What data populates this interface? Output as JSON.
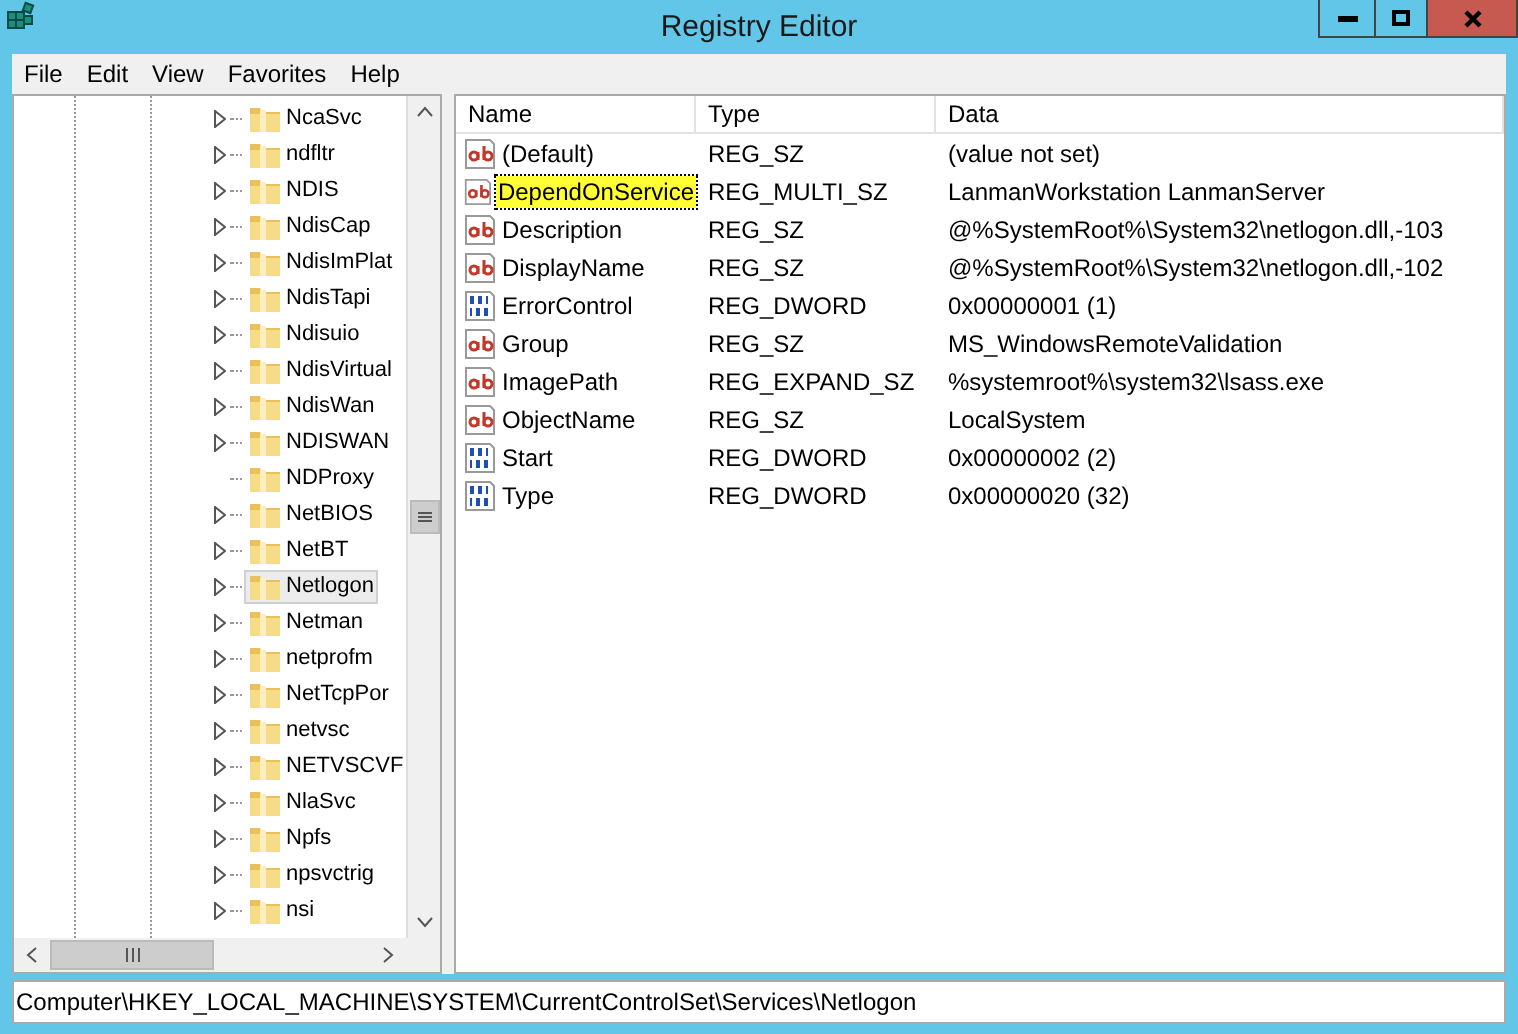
{
  "window": {
    "title": "Registry Editor"
  },
  "menu": [
    "File",
    "Edit",
    "View",
    "Favorites",
    "Help"
  ],
  "tree": {
    "items": [
      {
        "label": "NcaSvc",
        "expandable": true,
        "selected": false
      },
      {
        "label": "ndfltr",
        "expandable": true,
        "selected": false
      },
      {
        "label": "NDIS",
        "expandable": true,
        "selected": false
      },
      {
        "label": "NdisCap",
        "expandable": true,
        "selected": false
      },
      {
        "label": "NdisImPlat",
        "expandable": true,
        "selected": false
      },
      {
        "label": "NdisTapi",
        "expandable": true,
        "selected": false
      },
      {
        "label": "Ndisuio",
        "expandable": true,
        "selected": false
      },
      {
        "label": "NdisVirtual",
        "expandable": true,
        "selected": false
      },
      {
        "label": "NdisWan",
        "expandable": true,
        "selected": false
      },
      {
        "label": "NDISWAN",
        "expandable": true,
        "selected": false
      },
      {
        "label": "NDProxy",
        "expandable": false,
        "selected": false
      },
      {
        "label": "NetBIOS",
        "expandable": true,
        "selected": false
      },
      {
        "label": "NetBT",
        "expandable": true,
        "selected": false
      },
      {
        "label": "Netlogon",
        "expandable": true,
        "selected": true
      },
      {
        "label": "Netman",
        "expandable": true,
        "selected": false
      },
      {
        "label": "netprofm",
        "expandable": true,
        "selected": false
      },
      {
        "label": "NetTcpPor",
        "expandable": true,
        "selected": false
      },
      {
        "label": "netvsc",
        "expandable": true,
        "selected": false
      },
      {
        "label": "NETVSCVF",
        "expandable": true,
        "selected": false
      },
      {
        "label": "NlaSvc",
        "expandable": true,
        "selected": false
      },
      {
        "label": "Npfs",
        "expandable": true,
        "selected": false
      },
      {
        "label": "npsvctrig",
        "expandable": true,
        "selected": false
      },
      {
        "label": "nsi",
        "expandable": true,
        "selected": false
      }
    ]
  },
  "table": {
    "columns": [
      "Name",
      "Type",
      "Data"
    ],
    "rows": [
      {
        "kind": "string",
        "name": "(Default)",
        "type": "REG_SZ",
        "data": "(value not set)",
        "selected": false
      },
      {
        "kind": "string",
        "name": "DependOnService",
        "type": "REG_MULTI_SZ",
        "data": "LanmanWorkstation LanmanServer",
        "selected": true
      },
      {
        "kind": "string",
        "name": "Description",
        "type": "REG_SZ",
        "data": "@%SystemRoot%\\System32\\netlogon.dll,-103",
        "selected": false
      },
      {
        "kind": "string",
        "name": "DisplayName",
        "type": "REG_SZ",
        "data": "@%SystemRoot%\\System32\\netlogon.dll,-102",
        "selected": false
      },
      {
        "kind": "binary",
        "name": "ErrorControl",
        "type": "REG_DWORD",
        "data": "0x00000001 (1)",
        "selected": false
      },
      {
        "kind": "string",
        "name": "Group",
        "type": "REG_SZ",
        "data": "MS_WindowsRemoteValidation",
        "selected": false
      },
      {
        "kind": "string",
        "name": "ImagePath",
        "type": "REG_EXPAND_SZ",
        "data": "%systemroot%\\system32\\lsass.exe",
        "selected": false
      },
      {
        "kind": "string",
        "name": "ObjectName",
        "type": "REG_SZ",
        "data": "LocalSystem",
        "selected": false
      },
      {
        "kind": "binary",
        "name": "Start",
        "type": "REG_DWORD",
        "data": "0x00000002 (2)",
        "selected": false
      },
      {
        "kind": "binary",
        "name": "Type",
        "type": "REG_DWORD",
        "data": "0x00000020 (32)",
        "selected": false
      }
    ]
  },
  "status_bar": "Computer\\HKEY_LOCAL_MACHINE\\SYSTEM\\CurrentControlSet\\Services\\Netlogon"
}
